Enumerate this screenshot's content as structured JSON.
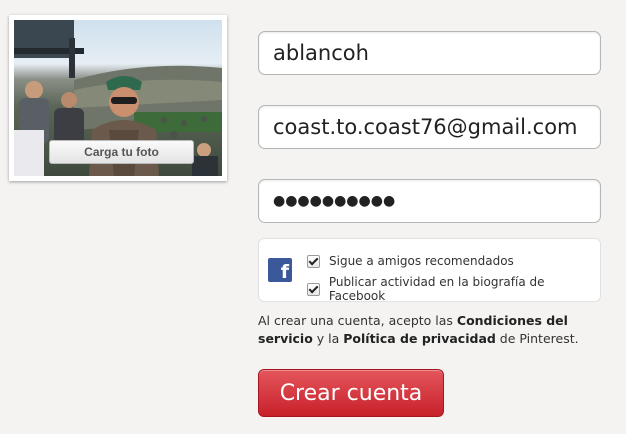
{
  "profile": {
    "upload_label": "Carga tu foto"
  },
  "form": {
    "username_value": "ablancoh",
    "email_value": "coast.to.coast76@gmail.com",
    "password_masked": "●●●●●●●●●●"
  },
  "facebook": {
    "icon_glyph": "f",
    "option_follow_label": "Sigue a amigos recomendados",
    "option_follow_checked": true,
    "option_publish_label": "Publicar actividad en la biografía de Facebook",
    "option_publish_checked": true
  },
  "terms": {
    "prefix": "Al crear una cuenta, acepto las ",
    "conditions_link": "Condiciones del servicio",
    "middle": " y la ",
    "privacy_link": "Política de privacidad",
    "suffix": " de Pinterest."
  },
  "submit_label": "Crear cuenta",
  "colors": {
    "primary_button": "#cb2027",
    "facebook_blue": "#3b5998"
  }
}
